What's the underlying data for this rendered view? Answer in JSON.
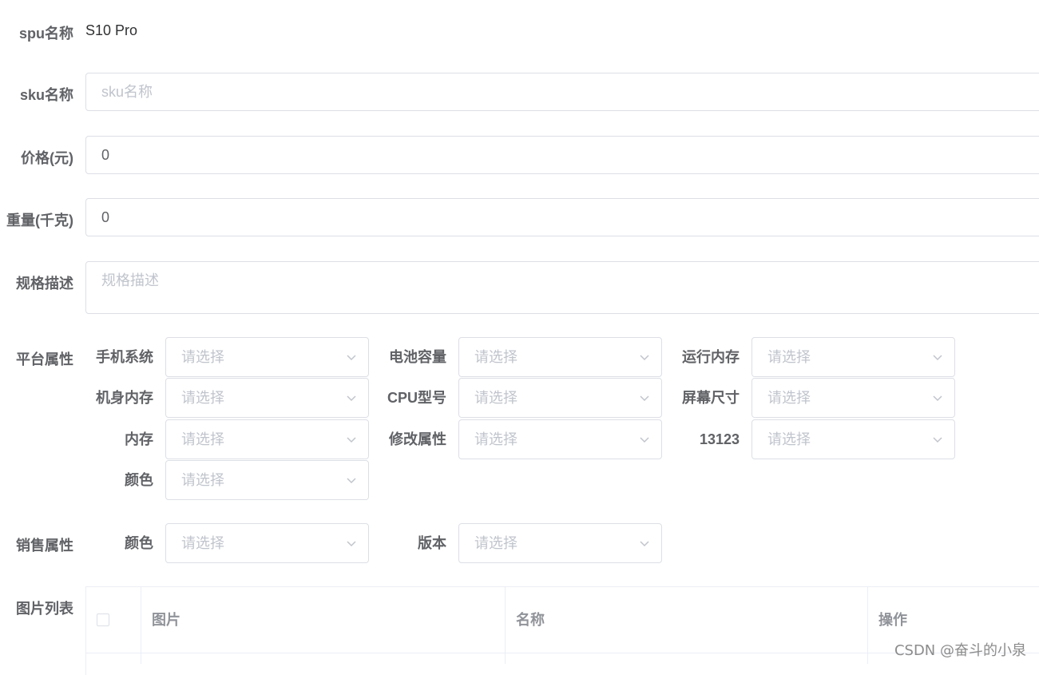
{
  "form": {
    "spu": {
      "label": "spu名称",
      "value": "S10 Pro"
    },
    "sku": {
      "label": "sku名称",
      "placeholder": "sku名称"
    },
    "price": {
      "label": "价格(元)",
      "value": "0"
    },
    "weight": {
      "label": "重量(千克)",
      "value": "0"
    },
    "desc": {
      "label": "规格描述",
      "placeholder": "规格描述"
    },
    "platform": {
      "label": "平台属性",
      "items": [
        {
          "label": "手机系统",
          "placeholder": "请选择"
        },
        {
          "label": "电池容量",
          "placeholder": "请选择"
        },
        {
          "label": "运行内存",
          "placeholder": "请选择"
        },
        {
          "label": "机身内存",
          "placeholder": "请选择"
        },
        {
          "label": "CPU型号",
          "placeholder": "请选择"
        },
        {
          "label": "屏幕尺寸",
          "placeholder": "请选择"
        },
        {
          "label": "内存",
          "placeholder": "请选择"
        },
        {
          "label": "修改属性",
          "placeholder": "请选择"
        },
        {
          "label": "13123",
          "placeholder": "请选择"
        },
        {
          "label": "颜色",
          "placeholder": "请选择"
        }
      ]
    },
    "sale": {
      "label": "销售属性",
      "items": [
        {
          "label": "颜色",
          "placeholder": "请选择"
        },
        {
          "label": "版本",
          "placeholder": "请选择"
        }
      ]
    },
    "images": {
      "label": "图片列表",
      "columns": [
        "图片",
        "名称",
        "操作"
      ]
    }
  },
  "watermark": "CSDN @奋斗的小泉",
  "icons": {
    "select_arrow": "chevron-down-icon",
    "table_select_all": "checkbox"
  }
}
